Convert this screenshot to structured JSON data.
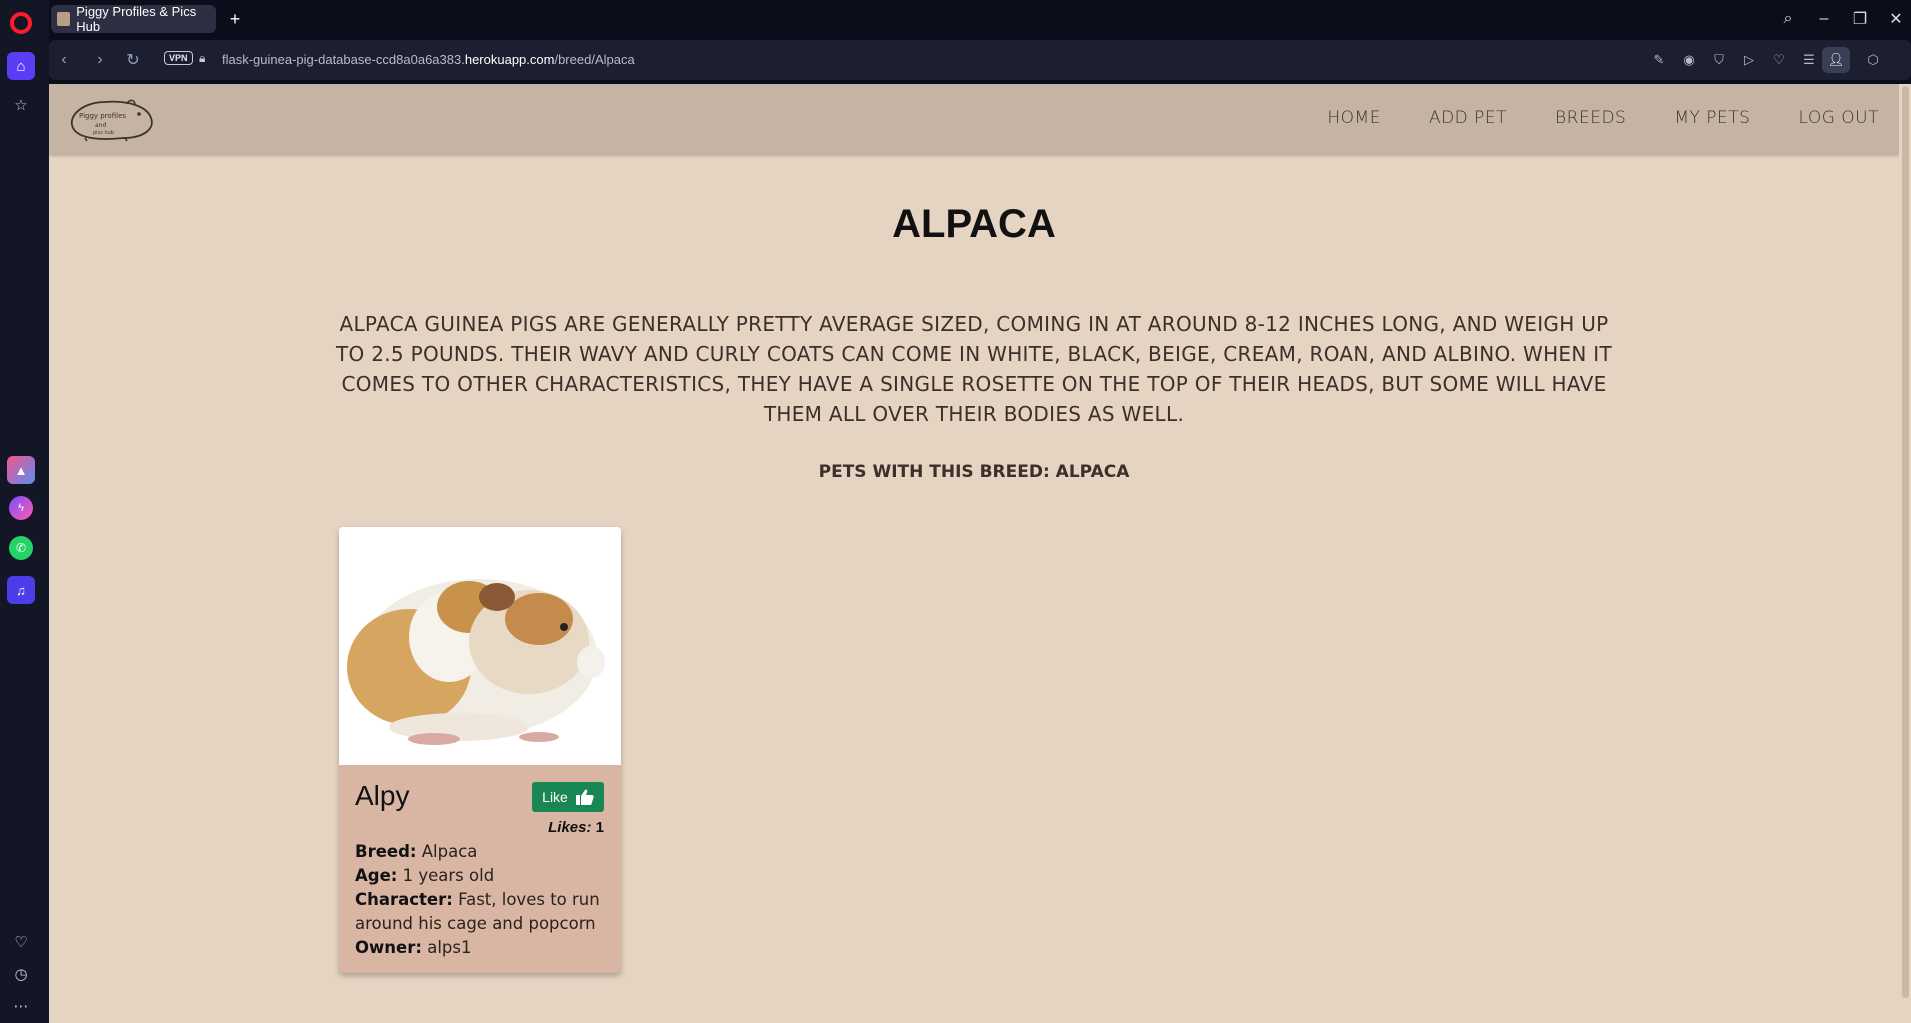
{
  "browser": {
    "tab_title": "Piggy Profiles & Pics Hub",
    "new_tab": "+",
    "vpn_label": "VPN",
    "url_prefix": "flask-guinea-pig-database-ccd8a0a6a383.",
    "url_domain": "herokuapp.com",
    "url_path": "/breed/Alpaca"
  },
  "navbar": {
    "logo_text": "Piggy profiles and pics hub",
    "links": [
      "HOME",
      "ADD PET",
      "BREEDS",
      "MY PETS",
      "LOG OUT"
    ]
  },
  "breed": {
    "title": "ALPACA",
    "description": "ALPACA GUINEA PIGS ARE GENERALLY PRETTY AVERAGE SIZED, COMING IN AT AROUND 8-12 INCHES LONG, AND WEIGH UP TO 2.5 POUNDS. THEIR WAVY AND CURLY COATS CAN COME IN WHITE, BLACK, BEIGE, CREAM, ROAN, AND ALBINO. WHEN IT COMES TO OTHER CHARACTERISTICS, THEY HAVE A SINGLE ROSETTE ON THE TOP OF THEIR HEADS, BUT SOME WILL HAVE THEM ALL OVER THEIR BODIES AS WELL.",
    "pets_heading": "PETS WITH THIS BREED: ALPACA"
  },
  "pets": [
    {
      "name": "Alpy",
      "like_label": "Like",
      "likes_label": "Likes:",
      "likes": "1",
      "breed_label": "Breed:",
      "breed": "Alpaca",
      "age_label": "Age:",
      "age": "1 years old",
      "character_label": "Character:",
      "character": "Fast, loves to run around his cage and popcorn",
      "owner_label": "Owner:",
      "owner": "alps1"
    }
  ],
  "colors": {
    "page_bg": "#e6d4c3",
    "navbar_bg": "#c5b3a4",
    "card_bg": "#d8b6a3",
    "like_button": "#198754"
  }
}
